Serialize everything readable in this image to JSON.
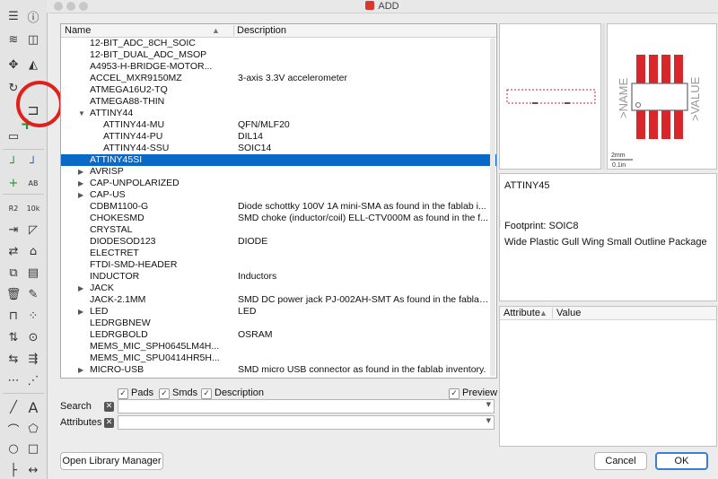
{
  "window": {
    "title": "ADD"
  },
  "tree": {
    "col_name": "Name",
    "col_desc": "Description",
    "rows": [
      {
        "name": "12-BIT_ADC_8CH_SOIC",
        "desc": "",
        "indent": 1,
        "arrow": ""
      },
      {
        "name": "12-BIT_DUAL_ADC_MSOP",
        "desc": "",
        "indent": 1,
        "arrow": ""
      },
      {
        "name": "A4953-H-BRIDGE-MOTOR...",
        "desc": "",
        "indent": 1,
        "arrow": ""
      },
      {
        "name": "ACCEL_MXR9150MZ",
        "desc": "3-axis 3.3V accelerometer",
        "indent": 1,
        "arrow": ""
      },
      {
        "name": "ATMEGA16U2-TQ",
        "desc": "",
        "indent": 1,
        "arrow": ""
      },
      {
        "name": "ATMEGA88-THIN",
        "desc": "",
        "indent": 1,
        "arrow": ""
      },
      {
        "name": "ATTINY44",
        "desc": "",
        "indent": 1,
        "arrow": "▼"
      },
      {
        "name": "ATTINY44-MU",
        "desc": "QFN/MLF20",
        "indent": 2,
        "arrow": ""
      },
      {
        "name": "ATTINY44-PU",
        "desc": "DIL14",
        "indent": 2,
        "arrow": ""
      },
      {
        "name": "ATTINY44-SSU",
        "desc": "SOIC14",
        "indent": 2,
        "arrow": ""
      },
      {
        "name": "ATTINY45SI",
        "desc": "",
        "indent": 1,
        "arrow": "",
        "selected": true
      },
      {
        "name": "AVRISP",
        "desc": "",
        "indent": 1,
        "arrow": "▶"
      },
      {
        "name": "CAP-UNPOLARIZED",
        "desc": "",
        "indent": 1,
        "arrow": "▶"
      },
      {
        "name": "CAP-US",
        "desc": "",
        "indent": 1,
        "arrow": "▶"
      },
      {
        "name": "CDBM1100-G",
        "desc": "Diode schottky 100V 1A mini-SMA as found in the fablab i...",
        "indent": 1,
        "arrow": ""
      },
      {
        "name": "CHOKESMD",
        "desc": "SMD choke (inductor/coil) ELL-CTV000M as found in the f...",
        "indent": 1,
        "arrow": ""
      },
      {
        "name": "CRYSTAL",
        "desc": "",
        "indent": 1,
        "arrow": ""
      },
      {
        "name": "DIODESOD123",
        "desc": "DIODE",
        "indent": 1,
        "arrow": ""
      },
      {
        "name": "ELECTRET",
        "desc": "",
        "indent": 1,
        "arrow": ""
      },
      {
        "name": "FTDI-SMD-HEADER",
        "desc": "",
        "indent": 1,
        "arrow": ""
      },
      {
        "name": "INDUCTOR",
        "desc": "Inductors",
        "indent": 1,
        "arrow": ""
      },
      {
        "name": "JACK",
        "desc": "",
        "indent": 1,
        "arrow": "▶"
      },
      {
        "name": "JACK-2.1MM",
        "desc": "SMD DC power jack PJ-002AH-SMT As found in the fablab ...",
        "indent": 1,
        "arrow": ""
      },
      {
        "name": "LED",
        "desc": "LED",
        "indent": 1,
        "arrow": "▶"
      },
      {
        "name": "LEDRGBNEW",
        "desc": "",
        "indent": 1,
        "arrow": ""
      },
      {
        "name": "LEDRGBOLD",
        "desc": "OSRAM",
        "indent": 1,
        "arrow": ""
      },
      {
        "name": "MEMS_MIC_SPH0645LM4H...",
        "desc": "",
        "indent": 1,
        "arrow": ""
      },
      {
        "name": "MEMS_MIC_SPU0414HR5H...",
        "desc": "",
        "indent": 1,
        "arrow": ""
      },
      {
        "name": "MICRO-USB",
        "desc": "SMD micro USB connector as found in the fablab inventory.",
        "indent": 1,
        "arrow": "▶"
      }
    ]
  },
  "filters": {
    "pads": "Pads",
    "smds": "Smds",
    "description": "Description",
    "preview": "Preview"
  },
  "search": {
    "label": "Search",
    "value": ""
  },
  "attributes": {
    "label": "Attributes",
    "value": ""
  },
  "package_preview": {
    "name_text": ">NAME",
    "value_text": ">VALUE",
    "scale_mm": "2mm",
    "scale_in": "0.1in"
  },
  "info": {
    "device": "ATTINY45",
    "footprint": "Footprint: SOIC8",
    "package_desc": "Wide Plastic Gull Wing Small Outline Package"
  },
  "attr_table": {
    "col_attribute": "Attribute",
    "col_value": "Value"
  },
  "buttons": {
    "library_manager": "Open Library Manager",
    "cancel": "Cancel",
    "ok": "OK"
  },
  "colors": {
    "selection": "#0a69c6",
    "pad": "#d8262b",
    "highlight_ring": "#e0201c"
  }
}
